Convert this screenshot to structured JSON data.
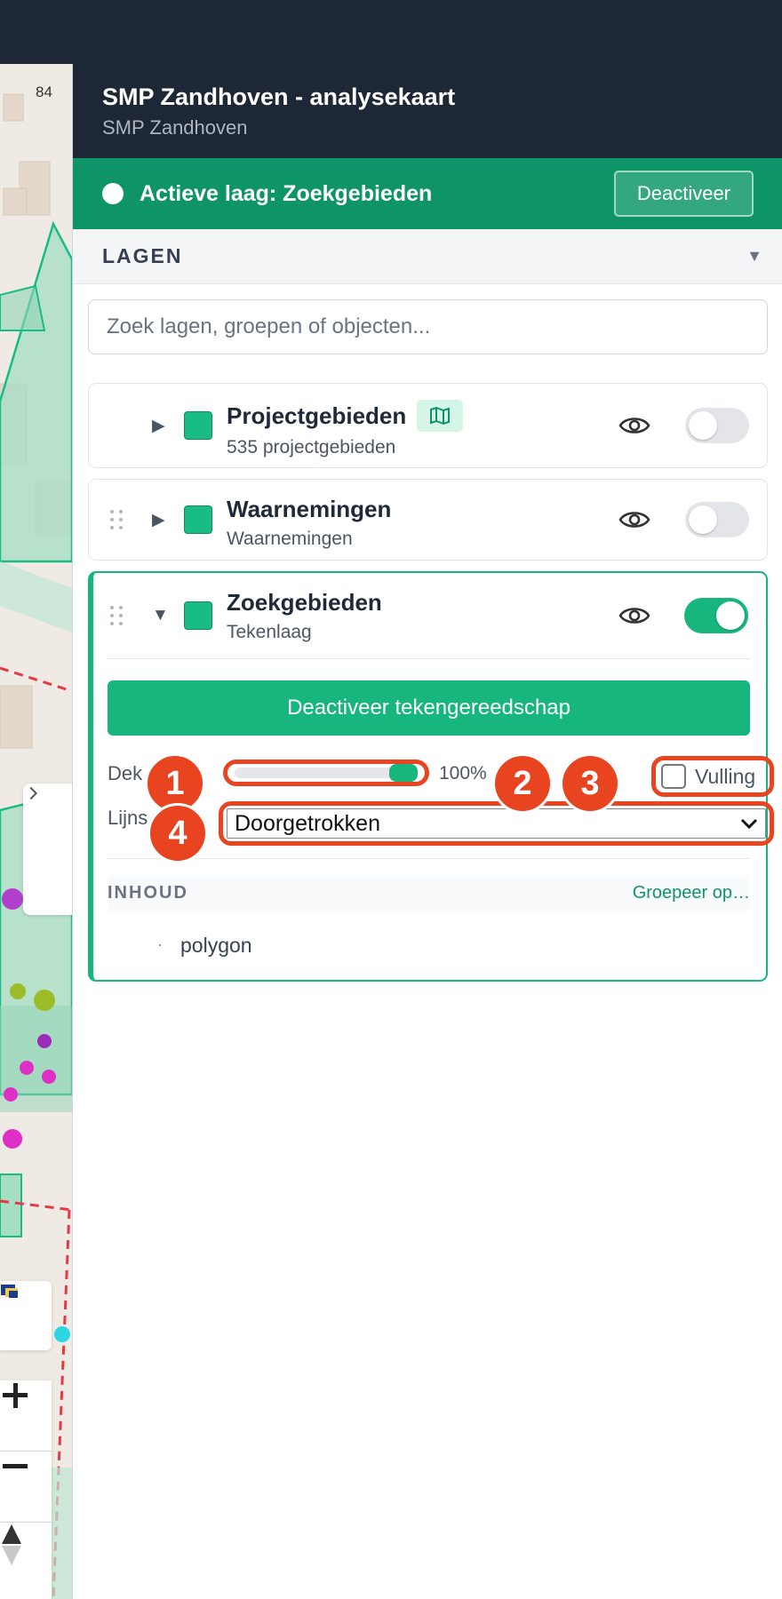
{
  "header": {
    "title": "SMP Zandhoven - analysekaart",
    "subtitle": "SMP Zandhoven"
  },
  "map": {
    "label": "84"
  },
  "active_layer": {
    "text": "Actieve laag: Zoekgebieden",
    "deactivate_label": "Deactiveer"
  },
  "layers_panel": {
    "title": "LAGEN",
    "search_placeholder": "Zoek lagen, groepen of objecten..."
  },
  "layers": [
    {
      "name": "Projectgebieden",
      "meta": "535 projectgebieden",
      "visible": false,
      "color": "#1abc86"
    },
    {
      "name": "Waarnemingen",
      "meta": "Waarnemingen",
      "visible": false,
      "color": "#1abc86"
    },
    {
      "name": "Zoekgebieden",
      "meta": "Tekenlaag",
      "visible": true,
      "color": "#1abc86"
    }
  ],
  "expanded_layer": {
    "tool_button": "Deactiveer tekengereedschap",
    "opacity_label": "Dek",
    "opacity_percent": "100%",
    "opacity_value": 1.0,
    "fill_label": "Vulling",
    "fill_checked": false,
    "line_label": "Lijns",
    "line_style": "Doorgetrokken",
    "content_title": "INHOUD",
    "group_by": "Groepeer op…",
    "content_items": [
      "polygon"
    ]
  },
  "markers": [
    "1",
    "2",
    "3",
    "4"
  ],
  "colors": {
    "accent": "#16b67d",
    "active_bar": "#0e9466",
    "header": "#1e2736",
    "marker": "#e8441f"
  }
}
